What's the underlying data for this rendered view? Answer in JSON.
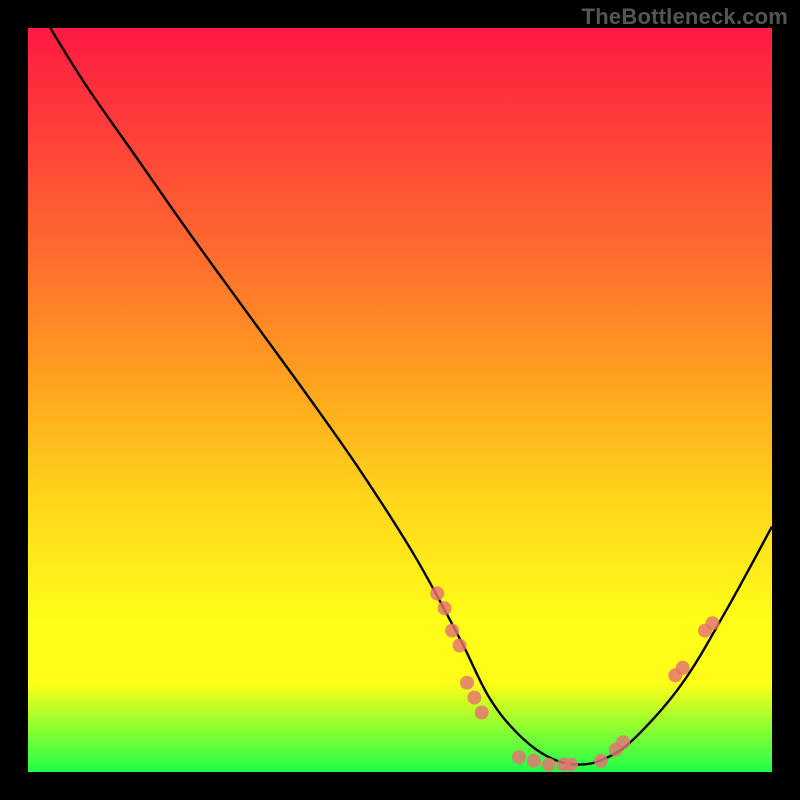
{
  "watermark": "TheBottleneck.com",
  "colors": {
    "dot": "#e57373",
    "curve": "#000000",
    "bg_black": "#000000"
  },
  "chart_data": {
    "type": "line",
    "title": "",
    "xlabel": "",
    "ylabel": "",
    "xlim": [
      0,
      100
    ],
    "ylim": [
      0,
      100
    ],
    "grid": false,
    "series": [
      {
        "name": "curve",
        "x": [
          3,
          8,
          15,
          22,
          30,
          38,
          45,
          52,
          58,
          62,
          66,
          70,
          74,
          78,
          82,
          88,
          94,
          100
        ],
        "y": [
          100,
          92,
          82,
          72,
          61,
          50,
          40,
          29,
          18,
          10,
          5,
          2,
          1,
          2,
          5,
          12,
          22,
          33
        ]
      }
    ],
    "points": [
      {
        "x": 55,
        "y": 24
      },
      {
        "x": 56,
        "y": 22
      },
      {
        "x": 57,
        "y": 19
      },
      {
        "x": 58,
        "y": 17
      },
      {
        "x": 59,
        "y": 12
      },
      {
        "x": 60,
        "y": 10
      },
      {
        "x": 61,
        "y": 8
      },
      {
        "x": 66,
        "y": 2
      },
      {
        "x": 68,
        "y": 1.5
      },
      {
        "x": 70,
        "y": 1
      },
      {
        "x": 72,
        "y": 1
      },
      {
        "x": 73,
        "y": 1
      },
      {
        "x": 77,
        "y": 1.5
      },
      {
        "x": 79,
        "y": 3
      },
      {
        "x": 80,
        "y": 4
      },
      {
        "x": 87,
        "y": 13
      },
      {
        "x": 88,
        "y": 14
      },
      {
        "x": 91,
        "y": 19
      },
      {
        "x": 92,
        "y": 20
      }
    ],
    "gradient_stops": [
      {
        "pos": 0,
        "color": "#ff1a42"
      },
      {
        "pos": 12,
        "color": "#ff3a3a"
      },
      {
        "pos": 30,
        "color": "#ff6a2f"
      },
      {
        "pos": 45,
        "color": "#ff9a1f"
      },
      {
        "pos": 62,
        "color": "#ffd21a"
      },
      {
        "pos": 80,
        "color": "#ffff17"
      },
      {
        "pos": 88,
        "color": "#ffff17"
      },
      {
        "pos": 100,
        "color": "#1eff4a"
      }
    ]
  }
}
